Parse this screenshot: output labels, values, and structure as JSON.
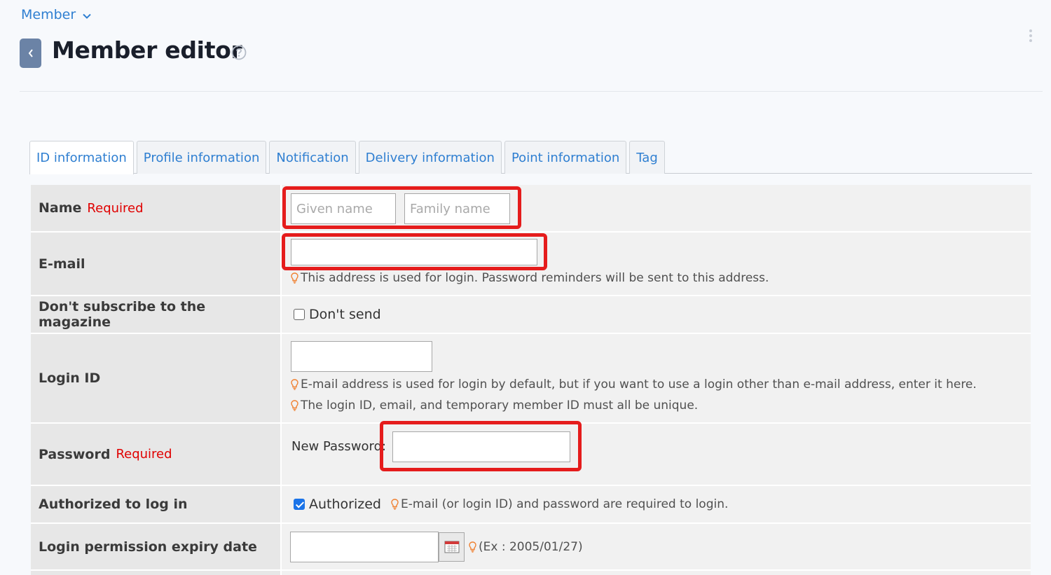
{
  "breadcrumb": {
    "label": "Member"
  },
  "page": {
    "title": "Member editor"
  },
  "tabs": [
    {
      "label": "ID information",
      "active": true
    },
    {
      "label": "Profile information"
    },
    {
      "label": "Notification"
    },
    {
      "label": "Delivery information"
    },
    {
      "label": "Point information"
    },
    {
      "label": "Tag"
    }
  ],
  "form": {
    "required_label": "Required",
    "name": {
      "label": "Name",
      "given_placeholder": "Given name",
      "family_placeholder": "Family name"
    },
    "email": {
      "label": "E-mail",
      "hint": "This address is used for login. Password reminders will be sent to this address."
    },
    "magazine": {
      "label": "Don't subscribe to the magazine",
      "option": "Don't send",
      "checked": false
    },
    "login_id": {
      "label": "Login ID",
      "hint1": "E-mail address is used for login by default, but if you want to use a login other than e-mail address, enter it here.",
      "hint2": "The login ID, email, and temporary member ID must all be unique."
    },
    "password": {
      "label": "Password",
      "new_label": "New Password:"
    },
    "authorized": {
      "label": "Authorized to log in",
      "option": "Authorized",
      "checked": true,
      "hint": "E-mail (or login ID) and password are required to login."
    },
    "expiry": {
      "label": "Login permission expiry date",
      "hint": "(Ex : 2005/01/27)"
    }
  },
  "colors": {
    "accent": "#2f7fd1",
    "required": "#e00000",
    "highlight": "#e51c1c",
    "hint_icon": "#f08030"
  }
}
